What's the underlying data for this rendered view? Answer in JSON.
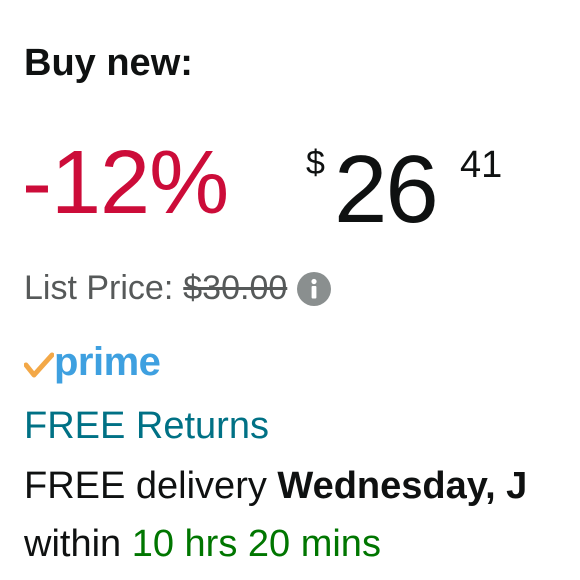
{
  "buy_box": {
    "heading": "Buy new:",
    "discount": "-12%",
    "price_symbol": "$",
    "price_whole": "26",
    "price_fraction": "41",
    "list_price_label": "List Price:",
    "list_price_value": "$30.00",
    "prime_label": "prime",
    "free_returns": "FREE Returns",
    "delivery_prefix": "FREE delivery ",
    "delivery_date": "Wednesday, J",
    "within_prefix": "within ",
    "countdown": "10 hrs 20 mins"
  },
  "icons": {
    "info": "info-icon",
    "prime_check": "check-icon"
  },
  "colors": {
    "discount": "#cc0c39",
    "link": "#007185",
    "countdown": "#007600",
    "prime_blue": "#3ea0e0",
    "prime_check": "#f3a847",
    "muted": "#565959"
  }
}
